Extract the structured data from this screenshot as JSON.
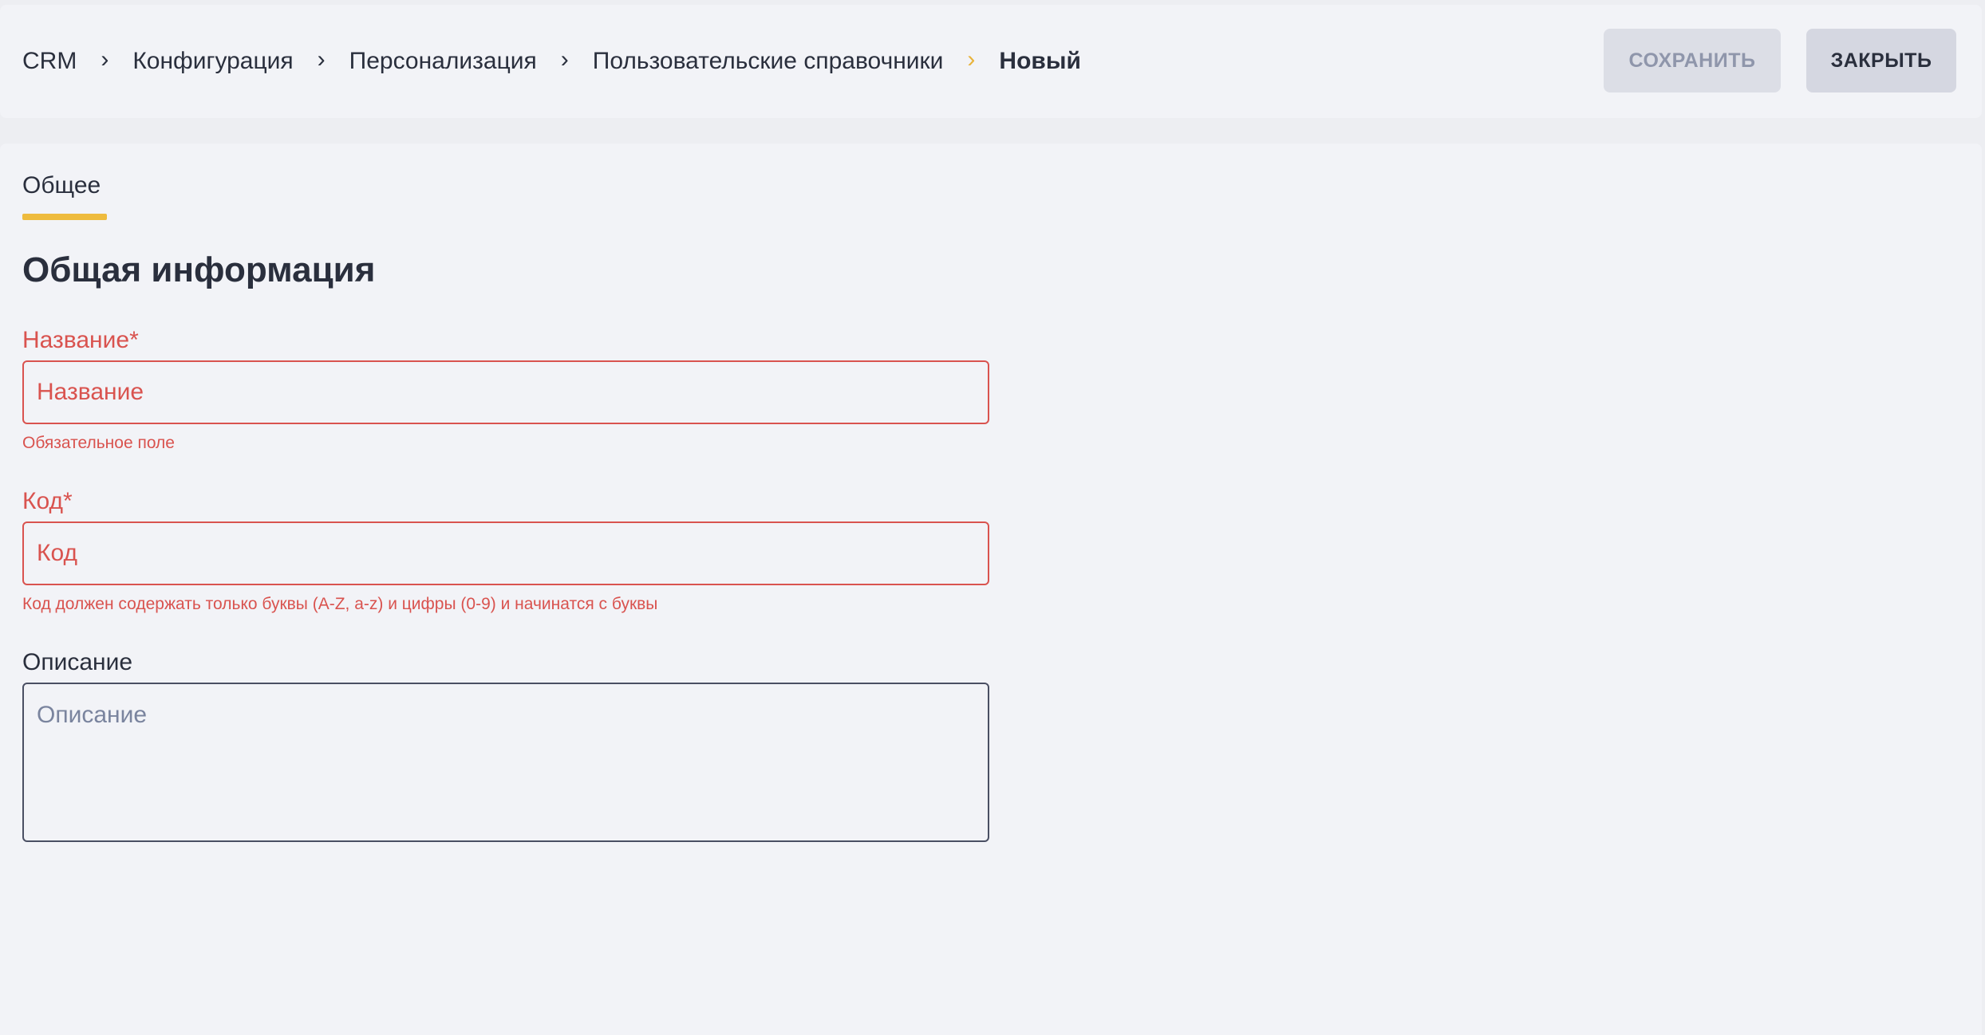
{
  "breadcrumb": {
    "items": [
      "CRM",
      "Конфигурация",
      "Персонализация",
      "Пользовательские справочники"
    ],
    "current": "Новый"
  },
  "toolbar": {
    "save_label": "СОХРАНИТЬ",
    "close_label": "ЗАКРЫТЬ"
  },
  "tabs": [
    {
      "label": "Общее",
      "active": true
    }
  ],
  "section": {
    "title": "Общая информация"
  },
  "form": {
    "name": {
      "label": "Название*",
      "placeholder": "Название",
      "value": "",
      "error": "Обязательное поле"
    },
    "code": {
      "label": "Код*",
      "placeholder": "Код",
      "value": "",
      "error": "Код должен содержать только буквы (A-Z, a-z) и цифры (0-9) и начинатся с буквы"
    },
    "description": {
      "label": "Описание",
      "placeholder": "Описание",
      "value": ""
    }
  },
  "colors": {
    "accent": "#eebb3e",
    "error": "#d9534f",
    "text": "#2a2f3d",
    "background": "#f2f3f7"
  }
}
